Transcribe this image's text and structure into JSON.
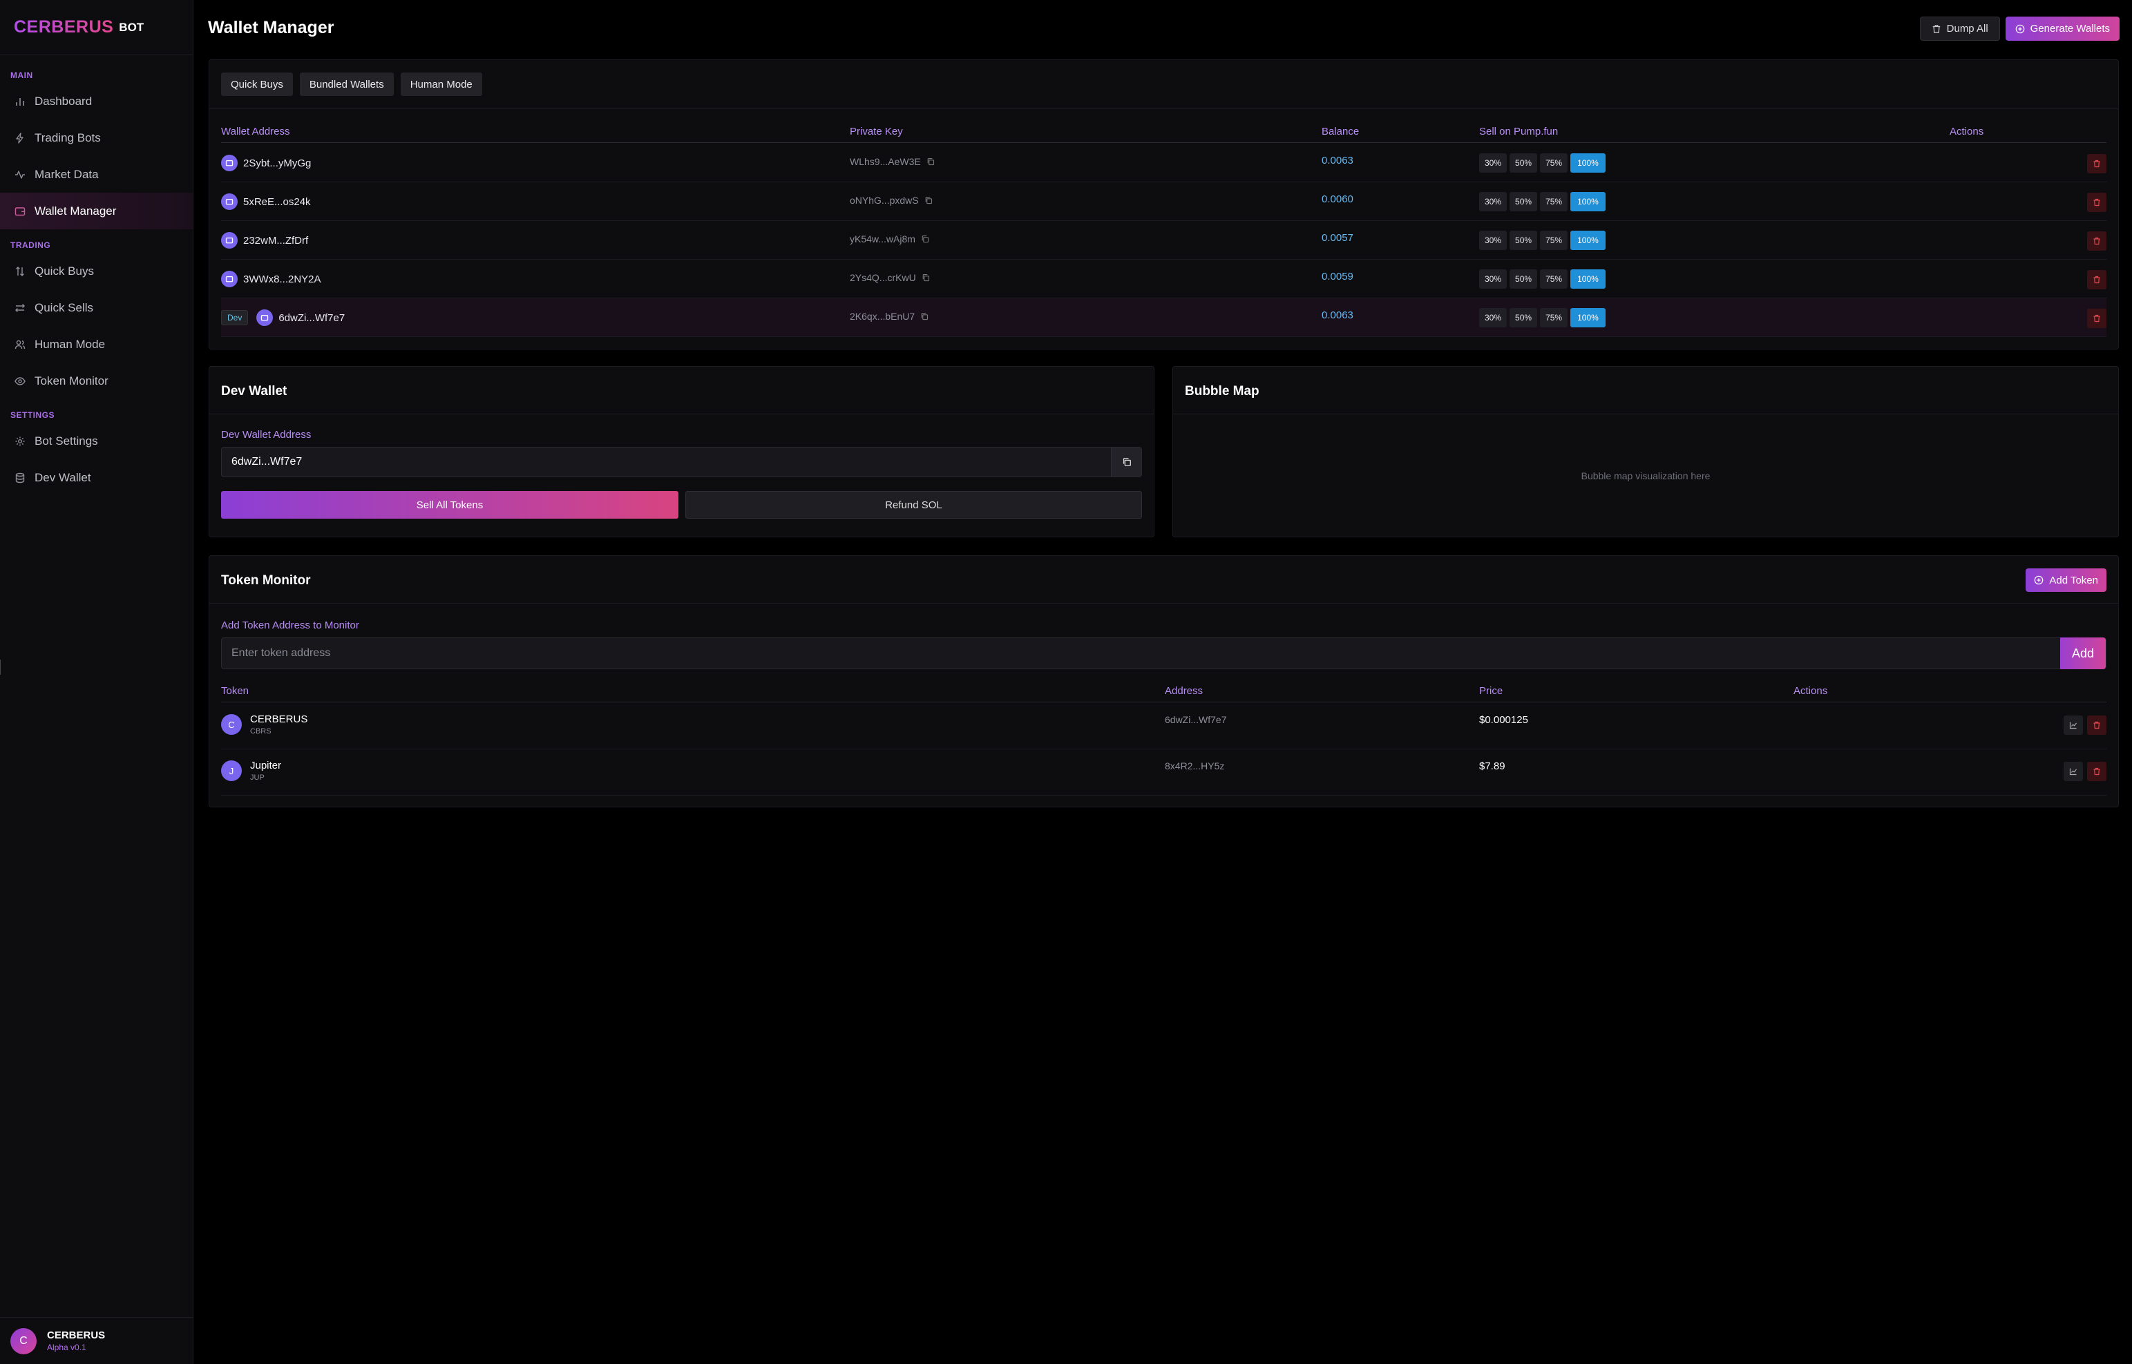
{
  "brand": {
    "name": "CERBERUS",
    "suffix": "BOT"
  },
  "sidebar": {
    "sections": [
      {
        "title": "MAIN",
        "items": [
          {
            "label": "Dashboard",
            "icon": "bar-chart-icon"
          },
          {
            "label": "Trading Bots",
            "icon": "zap-icon"
          },
          {
            "label": "Market Data",
            "icon": "activity-icon"
          },
          {
            "label": "Wallet Manager",
            "icon": "wallet-icon",
            "active": true
          }
        ]
      },
      {
        "title": "TRADING",
        "items": [
          {
            "label": "Quick Buys",
            "icon": "arrows-vertical-icon"
          },
          {
            "label": "Quick Sells",
            "icon": "arrows-horizontal-icon"
          },
          {
            "label": "Human Mode",
            "icon": "users-icon"
          },
          {
            "label": "Token Monitor",
            "icon": "eye-icon"
          }
        ]
      },
      {
        "title": "SETTINGS",
        "items": [
          {
            "label": "Bot Settings",
            "icon": "gear-icon"
          },
          {
            "label": "Dev Wallet",
            "icon": "database-icon"
          }
        ]
      }
    ],
    "user": {
      "avatar": "C",
      "name": "CERBERUS",
      "version": "Alpha v0.1"
    }
  },
  "header": {
    "title": "Wallet Manager",
    "dump_label": "Dump All",
    "generate_label": "Generate Wallets"
  },
  "wallets": {
    "tabs": [
      "Quick Buys",
      "Bundled Wallets",
      "Human Mode"
    ],
    "columns": {
      "address": "Wallet Address",
      "key": "Private Key",
      "balance": "Balance",
      "sell": "Sell on Pump.fun",
      "actions": "Actions"
    },
    "sell_options": [
      "30%",
      "50%",
      "75%",
      "100%"
    ],
    "rows": [
      {
        "address": "2Sybt...yMyGg",
        "key": "WLhs9...AeW3E",
        "balance": "0.0063",
        "dev": false
      },
      {
        "address": "5xReE...os24k",
        "key": "oNYhG...pxdwS",
        "balance": "0.0060",
        "dev": false
      },
      {
        "address": "232wM...ZfDrf",
        "key": "yK54w...wAj8m",
        "balance": "0.0057",
        "dev": false
      },
      {
        "address": "3WWx8...2NY2A",
        "key": "2Ys4Q...crKwU",
        "balance": "0.0059",
        "dev": false
      },
      {
        "address": "6dwZi...Wf7e7",
        "key": "2K6qx...bEnU7",
        "balance": "0.0063",
        "dev": true,
        "badge": "Dev"
      }
    ]
  },
  "dev_wallet": {
    "title": "Dev Wallet",
    "field_label": "Dev Wallet Address",
    "address": "6dwZi...Wf7e7",
    "sell_all_label": "Sell All Tokens",
    "refund_label": "Refund SOL"
  },
  "bubble_map": {
    "title": "Bubble Map",
    "placeholder": "Bubble map visualization here"
  },
  "token_monitor": {
    "title": "Token Monitor",
    "add_token_label": "Add Token",
    "field_label": "Add Token Address to Monitor",
    "input_placeholder": "Enter token address",
    "add_label": "Add",
    "columns": {
      "token": "Token",
      "address": "Address",
      "price": "Price",
      "actions": "Actions"
    },
    "rows": [
      {
        "icon": "C",
        "name": "CERBERUS",
        "symbol": "CBRS",
        "address": "6dwZi...Wf7e7",
        "price": "$0.000125"
      },
      {
        "icon": "J",
        "name": "Jupiter",
        "symbol": "JUP",
        "address": "8x4R2...HY5z",
        "price": "$7.89"
      }
    ]
  },
  "colors": {
    "accent_start": "#8b3fd6",
    "accent_end": "#d0449c",
    "balance": "#67b9f1",
    "danger": "#e0484d",
    "background": "#000000"
  }
}
